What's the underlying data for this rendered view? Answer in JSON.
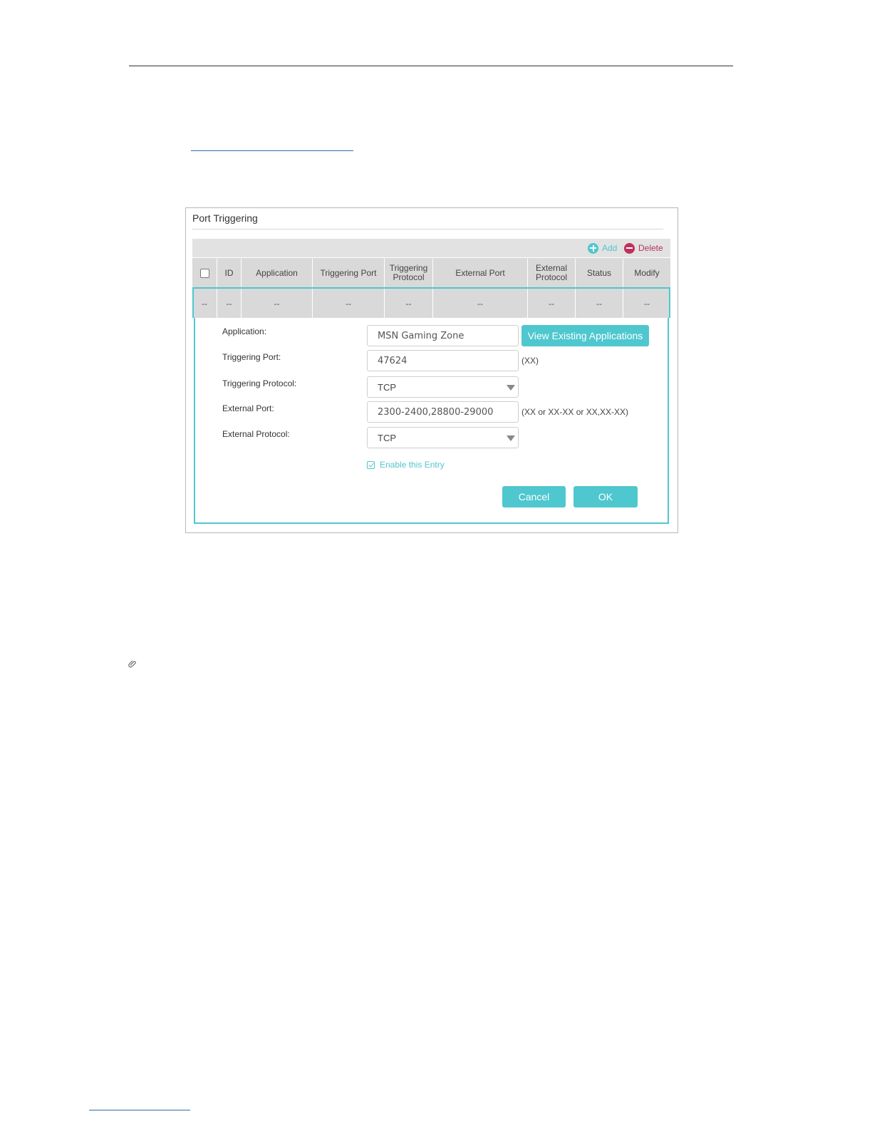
{
  "panel": {
    "title": "Port Triggering"
  },
  "toolbar": {
    "add_label": "Add",
    "delete_label": "Delete"
  },
  "table": {
    "columns": [
      "ID",
      "Application",
      "Triggering Port",
      "Triggering Protocol",
      "External Port",
      "External Protocol",
      "Status",
      "Modify"
    ],
    "row": [
      "--",
      "--",
      "--",
      "--",
      "--",
      "--",
      "--",
      "--",
      "--"
    ]
  },
  "form": {
    "application_label": "Application:",
    "application_value": "MSN Gaming Zone",
    "view_button": "View Existing Applications",
    "triggering_port_label": "Triggering Port:",
    "triggering_port_value": "47624",
    "triggering_port_hint": "(XX)",
    "triggering_protocol_label": "Triggering Protocol:",
    "triggering_protocol_value": "TCP",
    "external_port_label": "External Port:",
    "external_port_value": "2300-2400,28800-29000",
    "external_port_hint": "(XX or XX-XX or XX,XX-XX)",
    "external_protocol_label": "External Protocol:",
    "external_protocol_value": "TCP",
    "enable_label": "Enable this Entry",
    "cancel_label": "Cancel",
    "ok_label": "OK"
  },
  "colors": {
    "accent": "#4ec7cf",
    "delete": "#c0305c",
    "header_bg": "#d9d9d9"
  },
  "icons": [
    "add-circle-icon",
    "delete-circle-icon",
    "checkbox-icon",
    "dropdown-arrow-icon",
    "paperclip-icon"
  ]
}
